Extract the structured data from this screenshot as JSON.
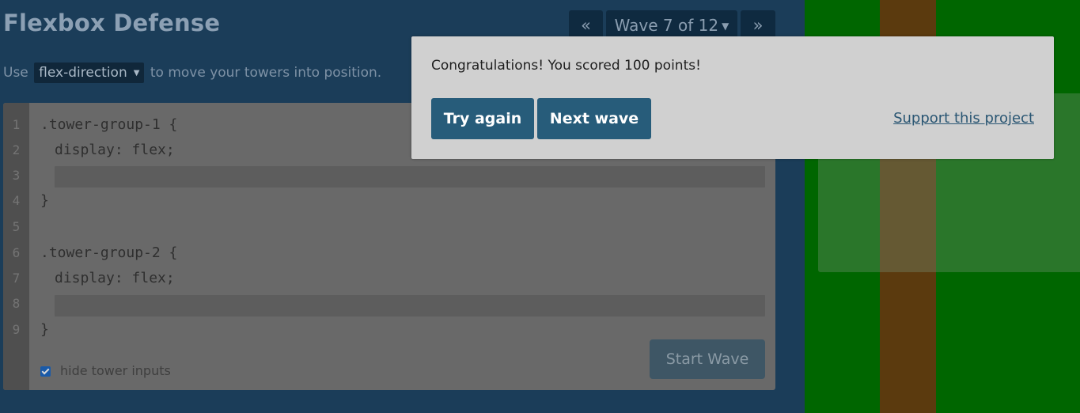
{
  "header": {
    "title": "Flexbox Defense",
    "instruction_prefix": "Use",
    "property": "flex-direction",
    "instruction_suffix": "to move your towers into position."
  },
  "wave_nav": {
    "prev_label": "«",
    "wave_label": "Wave 7 of 12",
    "next_label": "»"
  },
  "editor": {
    "line_numbers": [
      "1",
      "2",
      "3",
      "4",
      "5",
      "6",
      "7",
      "8",
      "9"
    ],
    "lines": [
      ".tower-group-1 {",
      "display: flex;",
      "",
      "}",
      "",
      ".tower-group-2 {",
      "display: flex;",
      "",
      "}"
    ],
    "input_1_value": "",
    "input_2_value": "",
    "hide_inputs_label": "hide tower inputs",
    "hide_inputs_checked": true,
    "start_wave_label": "Start Wave"
  },
  "modal": {
    "message": "Congratulations! You scored 100 points!",
    "try_again_label": "Try again",
    "next_wave_label": "Next wave",
    "support_label": "Support this project"
  },
  "colors": {
    "board_grass": "#006600",
    "board_path": "#5b3a0e",
    "modal_button": "#275c7a"
  }
}
